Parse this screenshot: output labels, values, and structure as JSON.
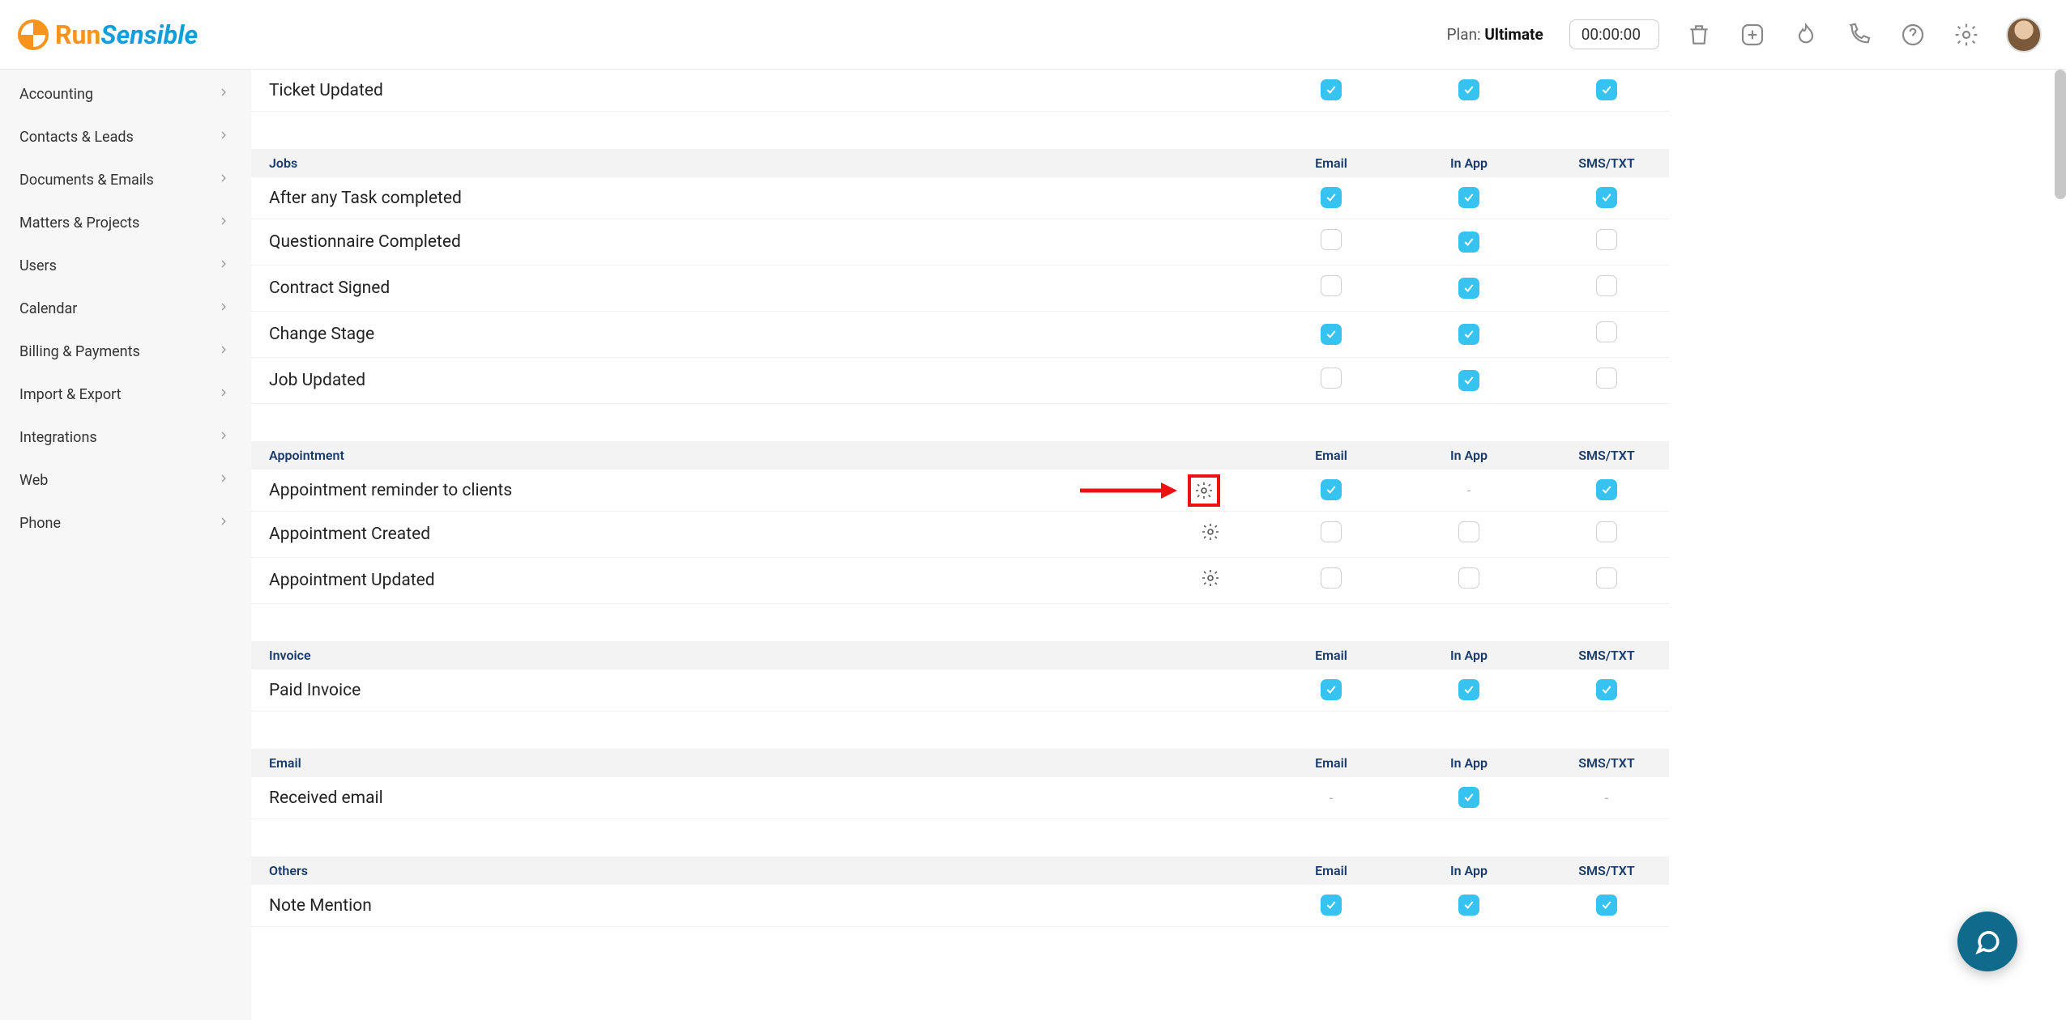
{
  "header": {
    "logo_run": "Run",
    "logo_sensible": "Sensible",
    "plan_label": "Plan:",
    "plan_value": "Ultimate",
    "timer": "00:00:00"
  },
  "sidebar": {
    "items": [
      {
        "label": "Accounting"
      },
      {
        "label": "Contacts & Leads"
      },
      {
        "label": "Documents & Emails"
      },
      {
        "label": "Matters & Projects"
      },
      {
        "label": "Users"
      },
      {
        "label": "Calendar"
      },
      {
        "label": "Billing & Payments"
      },
      {
        "label": "Import & Export"
      },
      {
        "label": "Integrations"
      },
      {
        "label": "Web"
      },
      {
        "label": "Phone"
      }
    ]
  },
  "columns": {
    "email": "Email",
    "inapp": "In App",
    "sms": "SMS/TXT"
  },
  "sections": [
    {
      "title": null,
      "rows": [
        {
          "label": "Ticket Updated",
          "gear": false,
          "email": "on",
          "inapp": "on",
          "sms": "on"
        }
      ]
    },
    {
      "title": "Jobs",
      "rows": [
        {
          "label": "After any Task completed",
          "gear": false,
          "email": "on",
          "inapp": "on",
          "sms": "on"
        },
        {
          "label": "Questionnaire Completed",
          "gear": false,
          "email": "off",
          "inapp": "on",
          "sms": "off"
        },
        {
          "label": "Contract Signed",
          "gear": false,
          "email": "off",
          "inapp": "on",
          "sms": "off"
        },
        {
          "label": "Change Stage",
          "gear": false,
          "email": "on",
          "inapp": "on",
          "sms": "off"
        },
        {
          "label": "Job Updated",
          "gear": false,
          "email": "off",
          "inapp": "on",
          "sms": "off"
        }
      ]
    },
    {
      "title": "Appointment",
      "rows": [
        {
          "label": "Appointment reminder to clients",
          "gear": true,
          "highlight": true,
          "arrow": true,
          "email": "on",
          "inapp": "dash",
          "sms": "on"
        },
        {
          "label": "Appointment Created",
          "gear": true,
          "email": "off",
          "inapp": "off",
          "sms": "off"
        },
        {
          "label": "Appointment Updated",
          "gear": true,
          "email": "off",
          "inapp": "off",
          "sms": "off"
        }
      ]
    },
    {
      "title": "Invoice",
      "rows": [
        {
          "label": "Paid Invoice",
          "gear": false,
          "email": "on",
          "inapp": "on",
          "sms": "on"
        }
      ]
    },
    {
      "title": "Email",
      "rows": [
        {
          "label": "Received email",
          "gear": false,
          "email": "dash",
          "inapp": "on",
          "sms": "dash"
        }
      ]
    },
    {
      "title": "Others",
      "rows": [
        {
          "label": "Note Mention",
          "gear": false,
          "email": "on",
          "inapp": "on",
          "sms": "on"
        }
      ]
    }
  ]
}
